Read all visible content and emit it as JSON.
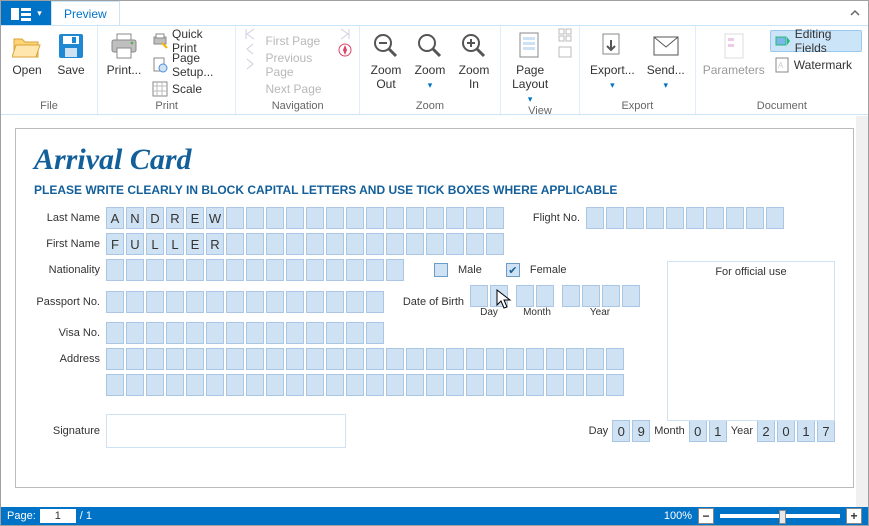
{
  "tabs": {
    "preview": "Preview"
  },
  "ribbon": {
    "file": {
      "label": "File",
      "open": "Open",
      "save": "Save"
    },
    "print": {
      "label": "Print",
      "print": "Print...",
      "quick": "Quick Print",
      "pagesetup": "Page Setup...",
      "scale": "Scale"
    },
    "nav": {
      "label": "Navigation",
      "first": "First Page",
      "prev": "Previous Page",
      "next": "Next Page"
    },
    "zoom": {
      "label": "Zoom",
      "out": "Zoom\nOut",
      "zoom": "Zoom",
      "in": "Zoom\nIn"
    },
    "view": {
      "label": "View",
      "pagelayout": "Page\nLayout"
    },
    "export": {
      "label": "Export",
      "export": "Export...",
      "send": "Send..."
    },
    "document": {
      "label": "Document",
      "params": "Parameters",
      "editing": "Editing Fields",
      "watermark": "Watermark"
    }
  },
  "doc": {
    "title": "Arrival Card",
    "instruction": "PLEASE WRITE CLEARLY IN BLOCK CAPITAL LETTERS AND USE TICK BOXES WHERE APPLICABLE",
    "labels": {
      "lastName": "Last Name",
      "firstName": "First Name",
      "nationality": "Nationality",
      "passport": "Passport No.",
      "visa": "Visa No.",
      "address": "Address",
      "flight": "Flight No.",
      "male": "Male",
      "female": "Female",
      "dob": "Date of Birth",
      "day": "Day",
      "month": "Month",
      "year": "Year",
      "official": "For official use",
      "signature": "Signature",
      "dayL": "Day",
      "monthL": "Month",
      "yearL": "Year"
    },
    "values": {
      "lastName": [
        "A",
        "N",
        "D",
        "R",
        "E",
        "W"
      ],
      "firstName": [
        "F",
        "U",
        "L",
        "L",
        "E",
        "R"
      ],
      "dateDay": [
        "0",
        "9"
      ],
      "dateMonth": [
        "0",
        "1"
      ],
      "dateYear": [
        "2",
        "0",
        "1",
        "7"
      ],
      "femaleChecked": true,
      "maleChecked": false
    }
  },
  "status": {
    "pageLabel": "Page:",
    "pageCurrent": "1",
    "pageTotal": "/ 1",
    "zoom": "100%"
  }
}
